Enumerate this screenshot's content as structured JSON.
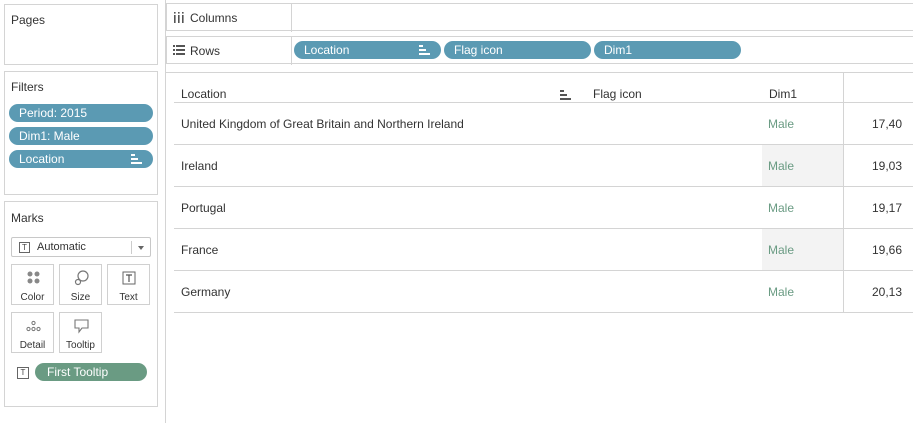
{
  "pages": {
    "title": "Pages"
  },
  "filters": {
    "title": "Filters",
    "items": [
      {
        "label": "Period: 2015",
        "sorted": false
      },
      {
        "label": "Dim1: Male",
        "sorted": false
      },
      {
        "label": "Location",
        "sorted": true
      }
    ]
  },
  "marks": {
    "title": "Marks",
    "mark_type": "Automatic",
    "buttons": {
      "color": "Color",
      "size": "Size",
      "text": "Text",
      "detail": "Detail",
      "tooltip": "Tooltip"
    },
    "text_icon_glyph": "T",
    "tooltip_pill": "First Tooltip"
  },
  "shelves": {
    "columns": {
      "label": "Columns",
      "icon": "columns-icon"
    },
    "rows": {
      "label": "Rows",
      "icon": "rows-icon",
      "pills": [
        {
          "label": "Location",
          "sorted": true
        },
        {
          "label": "Flag icon",
          "sorted": false
        },
        {
          "label": "Dim1",
          "sorted": false
        }
      ]
    }
  },
  "table": {
    "headers": {
      "location": "Location",
      "flag_icon": "Flag icon",
      "dim1": "Dim1"
    },
    "rows": [
      {
        "location": "United Kingdom of Great Britain and Northern Ireland",
        "dim1": "Male",
        "value": "17,40"
      },
      {
        "location": "Ireland",
        "dim1": "Male",
        "value": "19,03"
      },
      {
        "location": "Portugal",
        "dim1": "Male",
        "value": "19,17"
      },
      {
        "location": "France",
        "dim1": "Male",
        "value": "19,66"
      },
      {
        "location": "Germany",
        "dim1": "Male",
        "value": "20,13"
      }
    ]
  },
  "colors": {
    "dimension_pill": "#5b9ab3",
    "measure_pill": "#6a9b83",
    "dim_text": "#6a9b83"
  }
}
